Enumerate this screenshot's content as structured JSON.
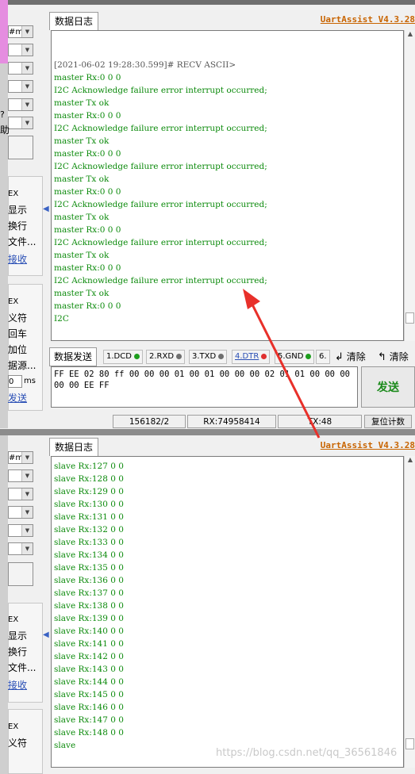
{
  "top_panel": {
    "tab_label": "数据日志",
    "brand": "UartAssist V4.3.28",
    "log_lines": [
      "[2021-06-02 19:28:30.599]# RECV ASCII>",
      "master Rx:0 0 0",
      "I2C Acknowledge failure error interrupt occurred;",
      "master Tx ok",
      "master Rx:0 0 0",
      "I2C Acknowledge failure error interrupt occurred;",
      "master Tx ok",
      "master Rx:0 0 0",
      "I2C Acknowledge failure error interrupt occurred;",
      "master Tx ok",
      "master Rx:0 0 0",
      "I2C Acknowledge failure error interrupt occurred;",
      "master Tx ok",
      "master Rx:0 0 0",
      "I2C Acknowledge failure error interrupt occurred;",
      "master Tx ok",
      "master Rx:0 0 0",
      "I2C Acknowledge failure error interrupt occurred;",
      "master Tx ok",
      "master Rx:0 0 0",
      "I2C"
    ],
    "left": {
      "combo_first": "#ml",
      "label_help": "助",
      "labels_a": [
        "EX",
        "显示",
        "换行",
        "文件...",
        "接收"
      ],
      "labels_b": [
        "EX",
        "义符",
        "回车",
        "加位",
        "据源...",
        "ms",
        "发送"
      ],
      "interval_value": "0"
    }
  },
  "send": {
    "tab_label": "数据发送",
    "pins": [
      {
        "label": "1.DCD",
        "color": "#1e9e1e"
      },
      {
        "label": "2.RXD",
        "color": "#6f6f6f"
      },
      {
        "label": "3.TXD",
        "color": "#6f6f6f"
      },
      {
        "label": "4.DTR",
        "color": "#e03030"
      },
      {
        "label": "5.GND",
        "color": "#1e9e1e"
      },
      {
        "label": "6.",
        "color": ""
      }
    ],
    "clear1": "清除",
    "clear2": "清除",
    "input_value": "FF EE 02 80 ff 00 00 00 01 00 01 00 00 00 02 01 01 00 00 00 00 00 EE FF",
    "send_button": "发送"
  },
  "statusbar": {
    "count": "156182/2",
    "rx": "RX:74958414",
    "tx": "TX:48",
    "reset": "复位计数"
  },
  "bottom_panel": {
    "tab_label": "数据日志",
    "brand": "UartAssist V4.3.28",
    "log_lines": [
      "slave Rx:127 0 0",
      "slave Rx:128 0 0",
      "slave Rx:129 0 0",
      "slave Rx:130 0 0",
      "slave Rx:131 0 0",
      "slave Rx:132 0 0",
      "slave Rx:133 0 0",
      "slave Rx:134 0 0",
      "slave Rx:135 0 0",
      "slave Rx:136 0 0",
      "slave Rx:137 0 0",
      "slave Rx:138 0 0",
      "slave Rx:139 0 0",
      "slave Rx:140 0 0",
      "slave Rx:141 0 0",
      "slave Rx:142 0 0",
      "slave Rx:143 0 0",
      "slave Rx:144 0 0",
      "slave Rx:145 0 0",
      "slave Rx:146 0 0",
      "slave Rx:147 0 0",
      "slave Rx:148 0 0",
      "slave"
    ],
    "left": {
      "combo_first": "#ml",
      "labels_a": [
        "EX",
        "显示",
        "换行",
        "文件...",
        "接收"
      ],
      "labels_b": [
        "EX",
        "义符"
      ]
    }
  },
  "watermark": "https://blog.csdn.net/qq_36561846",
  "colors": {
    "log_text": "#0b8a0b",
    "brand": "#c86400",
    "arrow": "#e8302a"
  }
}
